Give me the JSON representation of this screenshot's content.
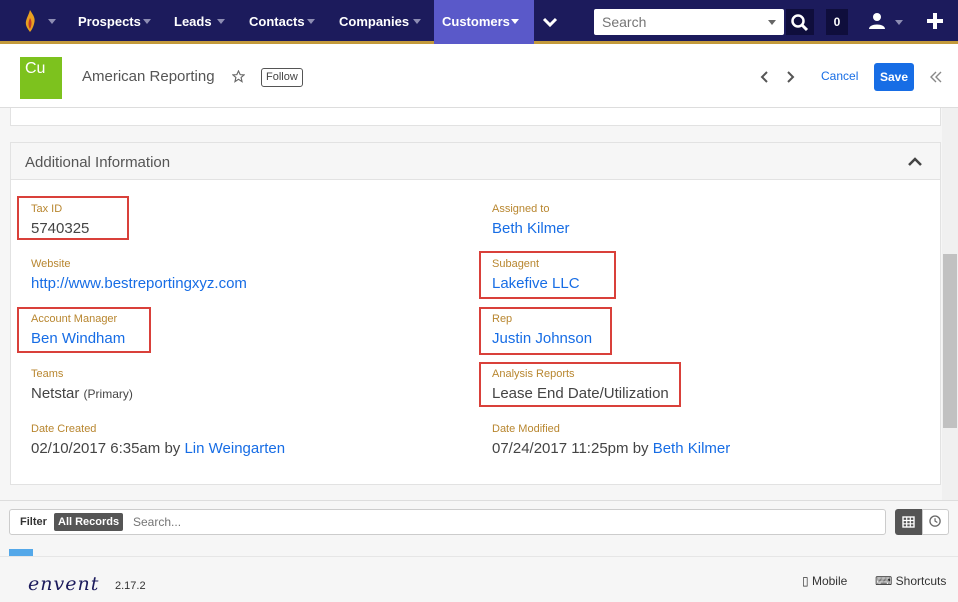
{
  "nav": {
    "items": [
      {
        "label": "Prospects"
      },
      {
        "label": "Leads"
      },
      {
        "label": "Contacts"
      },
      {
        "label": "Companies"
      },
      {
        "label": "Customers",
        "active": true
      }
    ],
    "search_placeholder": "Search",
    "notification_count": "0"
  },
  "record": {
    "module_abbr": "Cu",
    "title": "American Reporting",
    "follow_label": "Follow",
    "cancel_label": "Cancel",
    "save_label": "Save"
  },
  "panel": {
    "title": "Additional Information",
    "fields": {
      "tax_id": {
        "label": "Tax ID",
        "value": "5740325"
      },
      "assigned_to": {
        "label": "Assigned to",
        "value": "Beth Kilmer"
      },
      "website": {
        "label": "Website",
        "value": "http://www.bestreportingxyz.com"
      },
      "subagent": {
        "label": "Subagent",
        "value": "Lakefive LLC"
      },
      "account_manager": {
        "label": "Account Manager",
        "value": "Ben Windham"
      },
      "rep": {
        "label": "Rep",
        "value": "Justin Johnson"
      },
      "teams": {
        "label": "Teams",
        "value": "Netstar",
        "note": "(Primary)"
      },
      "analysis_reports": {
        "label": "Analysis Reports",
        "value": "Lease End Date/Utilization"
      },
      "date_created": {
        "label": "Date Created",
        "value": "02/10/2017 6:35am",
        "by": "by",
        "user": "Lin Weingarten"
      },
      "date_modified": {
        "label": "Date Modified",
        "value": "07/24/2017 11:25pm",
        "by": "by",
        "user": "Beth Kilmer"
      }
    }
  },
  "filter": {
    "label": "Filter",
    "all_records": "All Records",
    "search_placeholder": "Search..."
  },
  "footer": {
    "brand": "envent",
    "version": "2.17.2",
    "mobile": "Mobile",
    "shortcuts": "Shortcuts"
  },
  "colors": {
    "nav_bg": "#1c1b5c",
    "nav_active": "#5a59c9",
    "accent_gold": "#c39a3b",
    "link": "#176de5",
    "label": "#b8862f",
    "module_badge": "#7dc21e",
    "highlight": "#d9403a"
  }
}
